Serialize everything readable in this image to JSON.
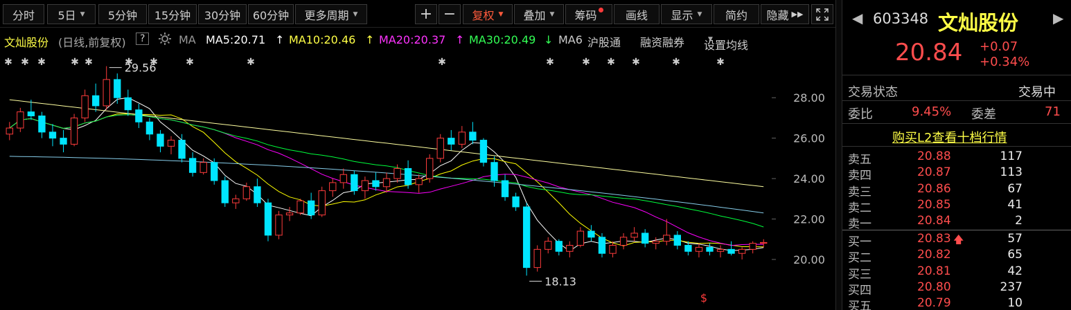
{
  "toolbar": {
    "periods": [
      "分时",
      "5日",
      "5分钟",
      "15分钟",
      "30分钟",
      "60分钟",
      "更多周期"
    ],
    "plus": "+",
    "minus": "−",
    "restore": "复权",
    "overlay": "叠加",
    "chips": "筹码",
    "draw": "画线",
    "display": "显示",
    "simple": "简约",
    "hide": "隐藏"
  },
  "ma_bar": {
    "stock": "文灿股份",
    "mode": "(日线,前复权)",
    "help": "?",
    "ma_label": "MA",
    "ma5": "MA5:20.71",
    "ma5_arrow": "↑",
    "ma10": "MA10:20.46",
    "ma10_arrow": "↑",
    "ma20": "MA20:20.37",
    "ma20_arrow": "↑",
    "ma30": "MA30:20.49",
    "ma30_arrow": "↓",
    "ma6": "MA6",
    "connect": "沪股通",
    "margin": "融资融券",
    "settings": "设置均线"
  },
  "chart_data": {
    "type": "candlestick",
    "y_ticks": [
      "28.00",
      "26.00",
      "24.00",
      "22.00",
      "20.00"
    ],
    "ylim": [
      17.5,
      30.3
    ],
    "annotations": {
      "high": "29.56",
      "low": "18.13"
    },
    "bottom_marker": "$",
    "colors": {
      "up": "#ff3c3c",
      "down": "#00e5ff",
      "ma5": "#ffffff",
      "ma10": "#ffff00",
      "ma20": "#ff00ff",
      "ma30": "#00ff3c",
      "ma60": "#87ceeb",
      "ma120": "#ffffa0"
    },
    "candles": [
      [
        26.2,
        26.8,
        25.9,
        26.5
      ],
      [
        26.5,
        27.5,
        26.3,
        27.3
      ],
      [
        27.3,
        27.9,
        26.9,
        27.1
      ],
      [
        27.1,
        27.3,
        26.0,
        26.3
      ],
      [
        26.3,
        26.7,
        25.6,
        26.0
      ],
      [
        26.0,
        26.4,
        25.3,
        25.7
      ],
      [
        25.7,
        27.2,
        25.6,
        27.0
      ],
      [
        27.0,
        28.4,
        26.8,
        28.1
      ],
      [
        28.1,
        28.7,
        27.3,
        27.6
      ],
      [
        27.6,
        29.56,
        27.4,
        28.9
      ],
      [
        28.9,
        29.2,
        27.7,
        28.0
      ],
      [
        28.0,
        28.4,
        27.1,
        27.4
      ],
      [
        27.4,
        27.7,
        26.5,
        26.8
      ],
      [
        26.8,
        27.0,
        25.9,
        26.2
      ],
      [
        26.2,
        26.4,
        25.3,
        25.6
      ],
      [
        25.6,
        26.1,
        25.2,
        25.9
      ],
      [
        25.9,
        26.2,
        24.8,
        25.0
      ],
      [
        25.0,
        25.3,
        24.1,
        24.3
      ],
      [
        24.3,
        25.0,
        24.2,
        24.8
      ],
      [
        24.8,
        25.0,
        23.7,
        23.9
      ],
      [
        23.9,
        24.1,
        22.6,
        22.8
      ],
      [
        22.8,
        23.2,
        22.5,
        23.0
      ],
      [
        23.0,
        23.8,
        22.9,
        23.6
      ],
      [
        23.6,
        24.0,
        22.6,
        22.8
      ],
      [
        22.8,
        23.0,
        20.9,
        21.2
      ],
      [
        21.2,
        22.4,
        21.0,
        22.2
      ],
      [
        22.2,
        22.6,
        21.9,
        22.3
      ],
      [
        22.3,
        23.0,
        22.2,
        22.9
      ],
      [
        22.9,
        23.3,
        22.0,
        22.2
      ],
      [
        22.2,
        23.6,
        22.1,
        23.4
      ],
      [
        23.4,
        24.0,
        23.1,
        23.8
      ],
      [
        23.8,
        24.5,
        23.5,
        24.2
      ],
      [
        24.2,
        24.4,
        23.2,
        23.4
      ],
      [
        23.4,
        24.1,
        23.0,
        23.9
      ],
      [
        23.9,
        24.3,
        23.4,
        23.6
      ],
      [
        23.6,
        24.3,
        23.3,
        24.0
      ],
      [
        24.0,
        24.7,
        23.8,
        24.5
      ],
      [
        24.5,
        24.9,
        23.5,
        23.7
      ],
      [
        23.7,
        24.2,
        23.3,
        24.0
      ],
      [
        24.0,
        25.2,
        23.8,
        25.0
      ],
      [
        25.0,
        26.2,
        24.8,
        26.0
      ],
      [
        26.0,
        26.4,
        25.4,
        25.7
      ],
      [
        25.7,
        26.6,
        25.5,
        26.3
      ],
      [
        26.3,
        26.8,
        25.7,
        25.9
      ],
      [
        25.9,
        26.0,
        24.6,
        24.8
      ],
      [
        24.8,
        25.1,
        23.6,
        23.9
      ],
      [
        23.9,
        24.2,
        22.9,
        23.1
      ],
      [
        23.1,
        23.3,
        22.4,
        22.6
      ],
      [
        22.6,
        22.8,
        19.2,
        19.6
      ],
      [
        19.6,
        20.7,
        19.4,
        20.5
      ],
      [
        20.5,
        21.1,
        20.3,
        20.9
      ],
      [
        20.9,
        21.0,
        20.2,
        20.4
      ],
      [
        20.4,
        20.9,
        20.1,
        20.7
      ],
      [
        20.7,
        21.6,
        20.6,
        21.4
      ],
      [
        21.4,
        21.7,
        20.9,
        21.1
      ],
      [
        21.1,
        21.3,
        20.1,
        20.3
      ],
      [
        20.3,
        20.9,
        20.1,
        20.7
      ],
      [
        20.7,
        21.3,
        20.5,
        21.1
      ],
      [
        21.1,
        21.6,
        20.9,
        21.3
      ],
      [
        21.3,
        21.5,
        20.6,
        20.8
      ],
      [
        20.8,
        21.1,
        20.5,
        20.9
      ],
      [
        20.9,
        22.0,
        20.7,
        21.2
      ],
      [
        21.2,
        21.4,
        20.5,
        20.7
      ],
      [
        20.7,
        20.9,
        20.2,
        20.4
      ],
      [
        20.4,
        20.8,
        20.1,
        20.6
      ],
      [
        20.6,
        20.8,
        20.2,
        20.4
      ],
      [
        20.4,
        20.7,
        20.1,
        20.5
      ],
      [
        20.5,
        20.9,
        20.2,
        20.3
      ],
      [
        20.3,
        20.6,
        20.0,
        20.5
      ],
      [
        20.5,
        20.9,
        20.3,
        20.8
      ],
      [
        20.8,
        21.0,
        20.6,
        20.84
      ]
    ]
  },
  "panel": {
    "code": "603348",
    "name": "文灿股份",
    "price": "20.84",
    "change": "+0.07",
    "change_pct": "+0.34%",
    "status_label": "交易状态",
    "status_value": "交易中",
    "weibi_label": "委比",
    "weibi_value": "9.45%",
    "weicha_label": "委差",
    "weicha_value": "71",
    "l2_link": "购买L2查看十档行情",
    "asks": [
      {
        "label": "卖五",
        "price": "20.88",
        "volume": "117"
      },
      {
        "label": "卖四",
        "price": "20.87",
        "volume": "113"
      },
      {
        "label": "卖三",
        "price": "20.86",
        "volume": "67"
      },
      {
        "label": "卖二",
        "price": "20.85",
        "volume": "41"
      },
      {
        "label": "卖一",
        "price": "20.84",
        "volume": "2"
      }
    ],
    "bids": [
      {
        "label": "买一",
        "price": "20.83",
        "volume": "57",
        "arrow": "🡅"
      },
      {
        "label": "买二",
        "price": "20.82",
        "volume": "65"
      },
      {
        "label": "买三",
        "price": "20.81",
        "volume": "42"
      },
      {
        "label": "买四",
        "price": "20.80",
        "volume": "237"
      },
      {
        "label": "买五",
        "price": "20.79",
        "volume": "10"
      }
    ]
  }
}
